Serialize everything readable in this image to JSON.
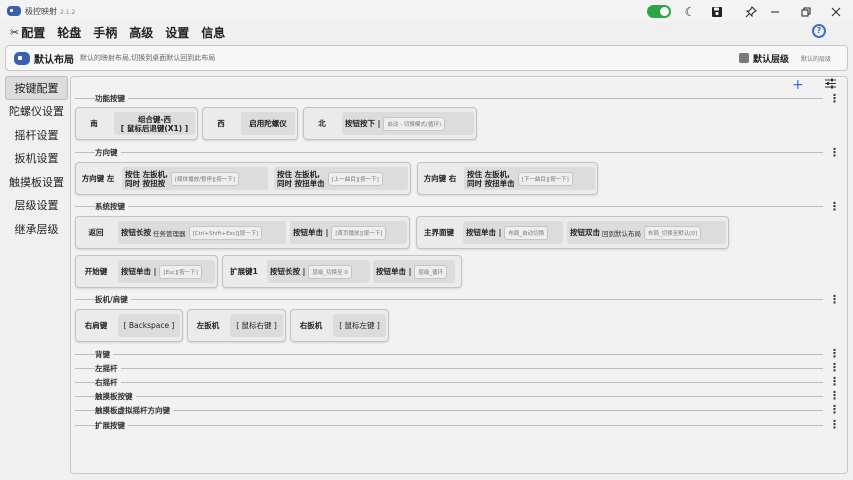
{
  "app": {
    "title": "极控映射",
    "version": "2.1.2"
  },
  "menu": [
    {
      "label": "配置",
      "icon": "tools-icon"
    },
    {
      "label": "轮盘"
    },
    {
      "label": "手柄"
    },
    {
      "label": "高级"
    },
    {
      "label": "设置"
    },
    {
      "label": "信息"
    }
  ],
  "layout_bar": {
    "name": "默认布局",
    "description": "默认的映射布局,切换到桌面默认回到此布局",
    "layer_name": "默认层级",
    "layer_sub": "默认的层级"
  },
  "sidebar": [
    {
      "label": "按键配置",
      "active": true
    },
    {
      "label": "陀螺仪设置",
      "active": false
    },
    {
      "label": "摇杆设置",
      "active": false
    },
    {
      "label": "扳机设置",
      "active": false
    },
    {
      "label": "触摸板设置",
      "active": false
    },
    {
      "label": "层级设置",
      "active": false
    },
    {
      "label": "继承层级",
      "active": false
    }
  ],
  "sections": {
    "func": {
      "title": "功能按键",
      "south_key": "南",
      "south_label1": "组合键-西",
      "south_label2": "[ 鼠标后退键(X1) ]",
      "west_key": "西",
      "west_label": "启用陀螺仪",
      "north_key": "北",
      "north_label": "按钮按下 |",
      "north_pill": "启动 - 切换模式(循环)"
    },
    "dpad": {
      "title": "方向键",
      "left_key": "方向键 左",
      "left_a1": "按住 左扳机,",
      "left_a2": "同时 按扭按",
      "left_a_pill": "[媒体播放/暂停][按一下]",
      "left_b1": "按住 左扳机,",
      "left_b2": "同时 按扭单击",
      "left_b_pill": "[上一曲目][按一下]",
      "right_key": "方向键 右",
      "right_a1": "按住 左扳机,",
      "right_a2": "同时 按扭单击",
      "right_a_pill": "[下一曲目][按一下]"
    },
    "system": {
      "title": "系统按键",
      "back_key": "返回",
      "back_a_label": "按钮长按",
      "back_a_val": "任务管理器",
      "back_a_pill": "[Ctrl+Shift+Esc][按一下]",
      "back_b_label": "按钮单击 |",
      "back_b_pill": "[首页播放][按一下]",
      "main_key": "主界面键",
      "main_a_label": "按钮单击 |",
      "main_a_pill": "布局_自动切换",
      "main_b_label": "按钮双击",
      "main_b_val": "回到默认布局",
      "main_b_pill": "布局_切换至默认[0]",
      "start_key": "开始键",
      "start_a_label": "按钮单击 |",
      "start_a_pill": "[Esc][按一下]",
      "ext_key": "扩展键1",
      "ext_a_label": "按钮长按 |",
      "ext_a_pill": "层级_切换至 0",
      "ext_b_label": "按钮单击 |",
      "ext_b_pill": "层级_循环"
    },
    "trigger": {
      "title": "扳机/肩键",
      "rb_key": "右肩键",
      "rb_val": "[ Backspace ]",
      "lt_key": "左扳机",
      "lt_val": "[ 鼠标右键 ]",
      "rt_key": "右扳机",
      "rt_val": "[ 鼠标左键 ]"
    },
    "collapsed": [
      "背键",
      "左摇杆",
      "右摇杆",
      "触摸板按键",
      "触摸板虚拟摇杆方向键",
      "扩展按键"
    ]
  },
  "colors": {
    "accent": "#3b6fd0",
    "toggle_on": "#29a745"
  }
}
